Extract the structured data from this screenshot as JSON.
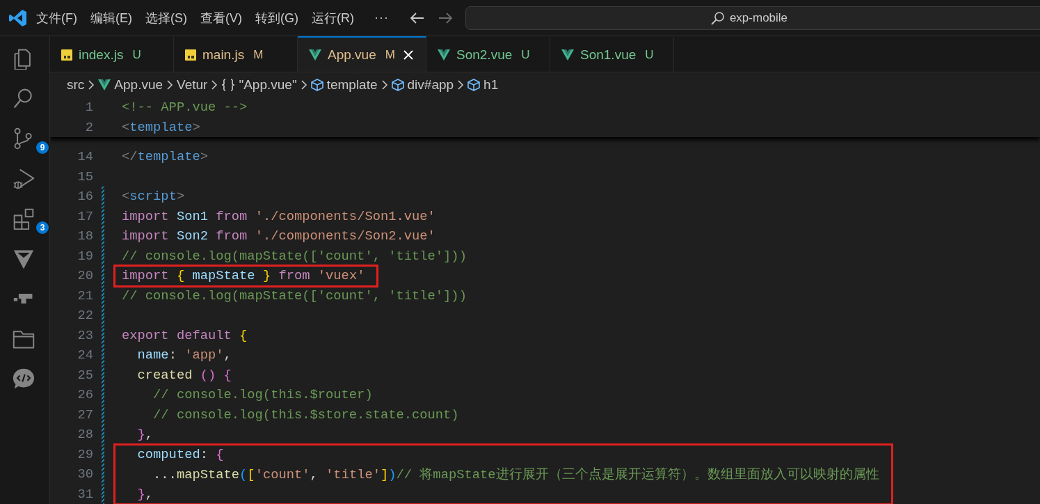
{
  "menu": {
    "items": [
      "文件(F)",
      "编辑(E)",
      "选择(S)",
      "查看(V)",
      "转到(G)",
      "运行(R)"
    ],
    "more": "···"
  },
  "navigation": {
    "back_disabled": false,
    "forward_disabled": true
  },
  "search": {
    "value": "exp-mobile"
  },
  "activity_bar": [
    {
      "kind": "explorer"
    },
    {
      "kind": "search"
    },
    {
      "kind": "source-control",
      "badge": "9"
    },
    {
      "kind": "debug"
    },
    {
      "kind": "extensions",
      "badge": "3"
    },
    {
      "kind": "triangle"
    },
    {
      "kind": "blocks"
    },
    {
      "kind": "folder"
    },
    {
      "kind": "chat"
    }
  ],
  "tabs": [
    {
      "label": "index.js",
      "kind": "js",
      "status": "U",
      "selected": false
    },
    {
      "label": "main.js",
      "kind": "js",
      "status": "M",
      "selected": false
    },
    {
      "label": "App.vue",
      "kind": "vue",
      "status": "M",
      "selected": true
    },
    {
      "label": "Son2.vue",
      "kind": "vue",
      "status": "U",
      "selected": false
    },
    {
      "label": "Son1.vue",
      "kind": "vue",
      "status": "U",
      "selected": false
    }
  ],
  "breadcrumb": [
    {
      "label": "src",
      "kind": "folder"
    },
    {
      "label": "App.vue",
      "kind": "vue"
    },
    {
      "label": "Vetur",
      "kind": "plugin"
    },
    {
      "label": "\"App.vue\"",
      "kind": "object"
    },
    {
      "label": "template",
      "kind": "element"
    },
    {
      "label": "div#app",
      "kind": "element"
    },
    {
      "label": "h1",
      "kind": "element"
    }
  ],
  "sticky_lines": [
    {
      "number": "1",
      "tokens": [
        {
          "t": "<!-- APP.vue -->",
          "kind": "comment"
        }
      ]
    },
    {
      "number": "2",
      "tokens": [
        {
          "t": "<",
          "kind": "punct"
        },
        {
          "t": "template",
          "kind": "tag"
        },
        {
          "t": ">",
          "kind": "punct"
        }
      ]
    }
  ],
  "code_lines": [
    {
      "number": "14",
      "modified": false,
      "boxed": false,
      "tokens": [
        {
          "t": "</",
          "kind": "punct"
        },
        {
          "t": "template",
          "kind": "tag"
        },
        {
          "t": ">",
          "kind": "punct"
        }
      ]
    },
    {
      "number": "15",
      "modified": false,
      "boxed": false
    },
    {
      "number": "16",
      "modified": true,
      "boxed": false,
      "tokens": [
        {
          "t": "<",
          "kind": "punct"
        },
        {
          "t": "script",
          "kind": "tag"
        },
        {
          "t": ">",
          "kind": "punct"
        }
      ]
    },
    {
      "number": "17",
      "modified": true,
      "boxed": false,
      "tokens": [
        {
          "t": "import ",
          "kind": "keyword"
        },
        {
          "t": "Son1 ",
          "kind": "variable"
        },
        {
          "t": "from ",
          "kind": "keyword"
        },
        {
          "t": "'./components/Son1.vue'",
          "kind": "string"
        }
      ]
    },
    {
      "number": "18",
      "modified": true,
      "boxed": false,
      "tokens": [
        {
          "t": "import ",
          "kind": "keyword"
        },
        {
          "t": "Son2 ",
          "kind": "variable"
        },
        {
          "t": "from ",
          "kind": "keyword"
        },
        {
          "t": "'./components/Son2.vue'",
          "kind": "string"
        }
      ]
    },
    {
      "number": "19",
      "modified": true,
      "boxed": false,
      "tokens": [
        {
          "t": "// console.log(mapState(['count', 'title']))",
          "kind": "comment"
        }
      ]
    },
    {
      "number": "20",
      "modified": true,
      "boxed": true,
      "tokens": [
        {
          "t": "import ",
          "kind": "keyword"
        },
        {
          "t": "{",
          "kind": "bracket1"
        },
        {
          "t": " mapState ",
          "kind": "variable"
        },
        {
          "t": "}",
          "kind": "bracket1"
        },
        {
          "t": " from ",
          "kind": "keyword"
        },
        {
          "t": "'vuex'",
          "kind": "string"
        }
      ]
    },
    {
      "number": "21",
      "modified": true,
      "boxed": false,
      "tokens": [
        {
          "t": "// console.log(mapState(['count', 'title']))",
          "kind": "comment"
        }
      ]
    },
    {
      "number": "22",
      "modified": true,
      "boxed": false
    },
    {
      "number": "23",
      "modified": true,
      "boxed": false,
      "tokens": [
        {
          "t": "export default ",
          "kind": "keyword"
        },
        {
          "t": "{",
          "kind": "bracket1"
        }
      ]
    },
    {
      "number": "24",
      "modified": true,
      "boxed": false,
      "tokens": [
        {
          "t": "  name",
          "kind": "variable"
        },
        {
          "t": ": ",
          "kind": "plain"
        },
        {
          "t": "'app'",
          "kind": "string"
        },
        {
          "t": ",",
          "kind": "plain"
        }
      ]
    },
    {
      "number": "25",
      "modified": true,
      "boxed": false,
      "tokens": [
        {
          "t": "  created ",
          "kind": "function"
        },
        {
          "t": "()",
          "kind": "bracket2"
        },
        {
          "t": " {",
          "kind": "bracket2"
        }
      ]
    },
    {
      "number": "26",
      "modified": true,
      "boxed": false,
      "tokens": [
        {
          "t": "    // console.log(this.$router)",
          "kind": "comment"
        }
      ]
    },
    {
      "number": "27",
      "modified": true,
      "boxed": false,
      "tokens": [
        {
          "t": "    // console.log(this.$store.state.count)",
          "kind": "comment"
        }
      ]
    },
    {
      "number": "28",
      "modified": true,
      "boxed": false,
      "tokens": [
        {
          "t": "  }",
          "kind": "bracket2"
        },
        {
          "t": ",",
          "kind": "plain"
        }
      ]
    },
    {
      "number": "29",
      "modified": true,
      "boxed": true,
      "tokens": [
        {
          "t": "  computed",
          "kind": "variable"
        },
        {
          "t": ": ",
          "kind": "plain"
        },
        {
          "t": "{",
          "kind": "bracket2"
        }
      ]
    },
    {
      "number": "30",
      "modified": true,
      "boxed": true,
      "tokens": [
        {
          "t": "    ...",
          "kind": "plain"
        },
        {
          "t": "mapState",
          "kind": "function"
        },
        {
          "t": "(",
          "kind": "bracket3"
        },
        {
          "t": "[",
          "kind": "bracket1"
        },
        {
          "t": "'count'",
          "kind": "string"
        },
        {
          "t": ", ",
          "kind": "plain"
        },
        {
          "t": "'title'",
          "kind": "string"
        },
        {
          "t": "]",
          "kind": "bracket1"
        },
        {
          "t": ")",
          "kind": "bracket3"
        },
        {
          "t": "// 将mapState进行展开（三个点是展开运算符）。数组里面放入可以映射的属性",
          "kind": "comment"
        }
      ]
    },
    {
      "number": "31",
      "modified": true,
      "boxed": true,
      "tokens": [
        {
          "t": "  }",
          "kind": "bracket2"
        },
        {
          "t": ",",
          "kind": "plain"
        }
      ]
    }
  ]
}
